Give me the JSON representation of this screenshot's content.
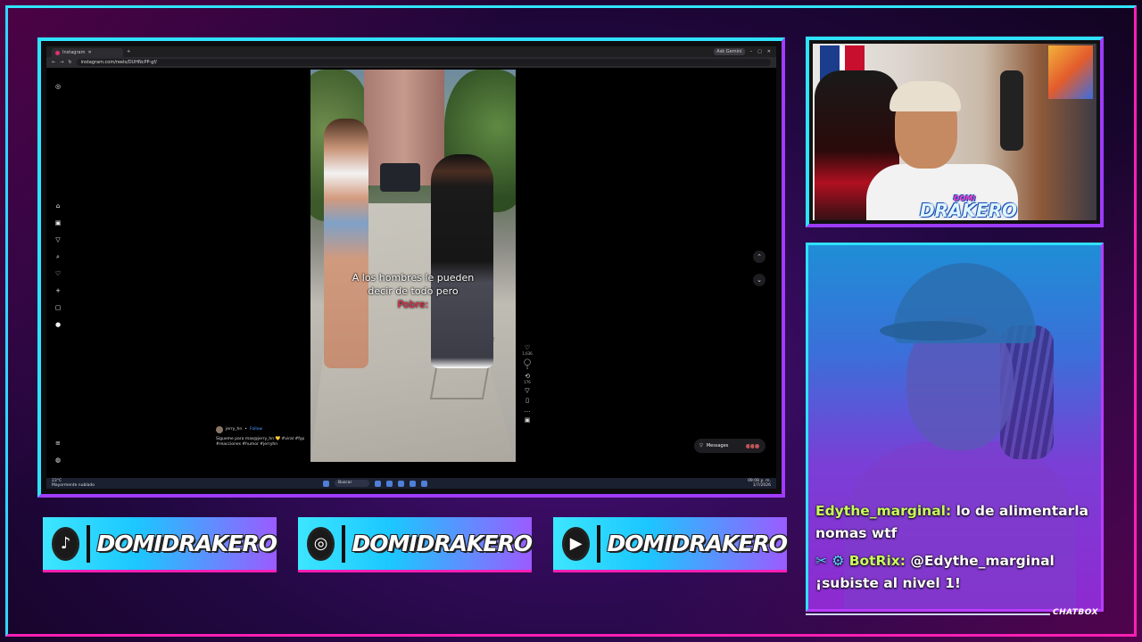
{
  "browser": {
    "tab_title": "Instagram",
    "url": "instagram.com/reels/DUHNcPP-gf/",
    "gemini_label": "Ask Gemini"
  },
  "reel": {
    "caption_line1": "A los hombres le pueden",
    "caption_line2": "decir de todo pero",
    "caption_red": "Pobre:",
    "username": "jerry_hn",
    "follow_label": "Follow",
    "description": "Sigueme para mas@jerry_hn 💛 #viral #fyp #reacciones #humor #jerryhn",
    "likes": "1,636",
    "comments": "5",
    "reposts": "176"
  },
  "messages_label": "Messages",
  "taskbar": {
    "weather_temp": "23°C",
    "weather_desc": "Mayormente nublado",
    "search_label": "Buscar",
    "time": "09:08 p. m.",
    "date": "1/7/2026"
  },
  "cam": {
    "logo_small": "DOMI",
    "logo_big": "DRAKERO"
  },
  "chat": {
    "msg1_user": "Edythe_marginal:",
    "msg1_text": " lo de alimentarla nomas wtf",
    "msg2_icons": "✂ ⚙",
    "msg2_user": "BotRix:",
    "msg2_text": " @Edythe_marginal ¡subiste al nivel 1!",
    "label": "CHATBOX"
  },
  "socials": [
    {
      "platform": "tiktok",
      "icon": "♪",
      "handle": "DOMIDRAKERO"
    },
    {
      "platform": "instagram",
      "icon": "◎",
      "handle": "DOMIDRAKERO"
    },
    {
      "platform": "youtube",
      "icon": "▶",
      "handle": "DOMIDRAKERO"
    }
  ]
}
